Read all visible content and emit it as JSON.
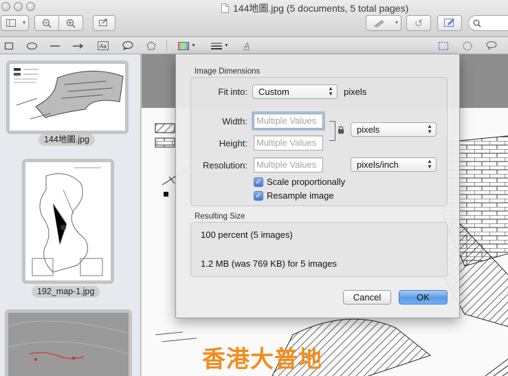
{
  "window": {
    "title": "144地圖.jpg (5 documents, 5 total pages)"
  },
  "toolbar": {
    "search_placeholder": "Q"
  },
  "sidebar": {
    "items": [
      {
        "label": "144地圖.jpg"
      },
      {
        "label": "192_map-1.jpg"
      },
      {
        "label": ""
      }
    ]
  },
  "document": {
    "watermark": "香港大普地"
  },
  "dialog": {
    "section_dimensions": "Image Dimensions",
    "fit_into_label": "Fit into:",
    "fit_into_value": "Custom",
    "fit_into_unit": "pixels",
    "width_label": "Width:",
    "height_label": "Height:",
    "resolution_label": "Resolution:",
    "width_placeholder": "Multiple Values",
    "height_placeholder": "Multiple Values",
    "resolution_placeholder": "Multiple Values",
    "size_unit": "pixels",
    "resolution_unit": "pixels/inch",
    "scale_label": "Scale proportionally",
    "scale_checked": true,
    "resample_label": "Resample image",
    "resample_checked": true,
    "section_result": "Resulting Size",
    "result_percent": "100 percent (5 images)",
    "result_size": "1.2 MB (was 769 KB) for 5 images",
    "cancel_label": "Cancel",
    "ok_label": "OK"
  }
}
